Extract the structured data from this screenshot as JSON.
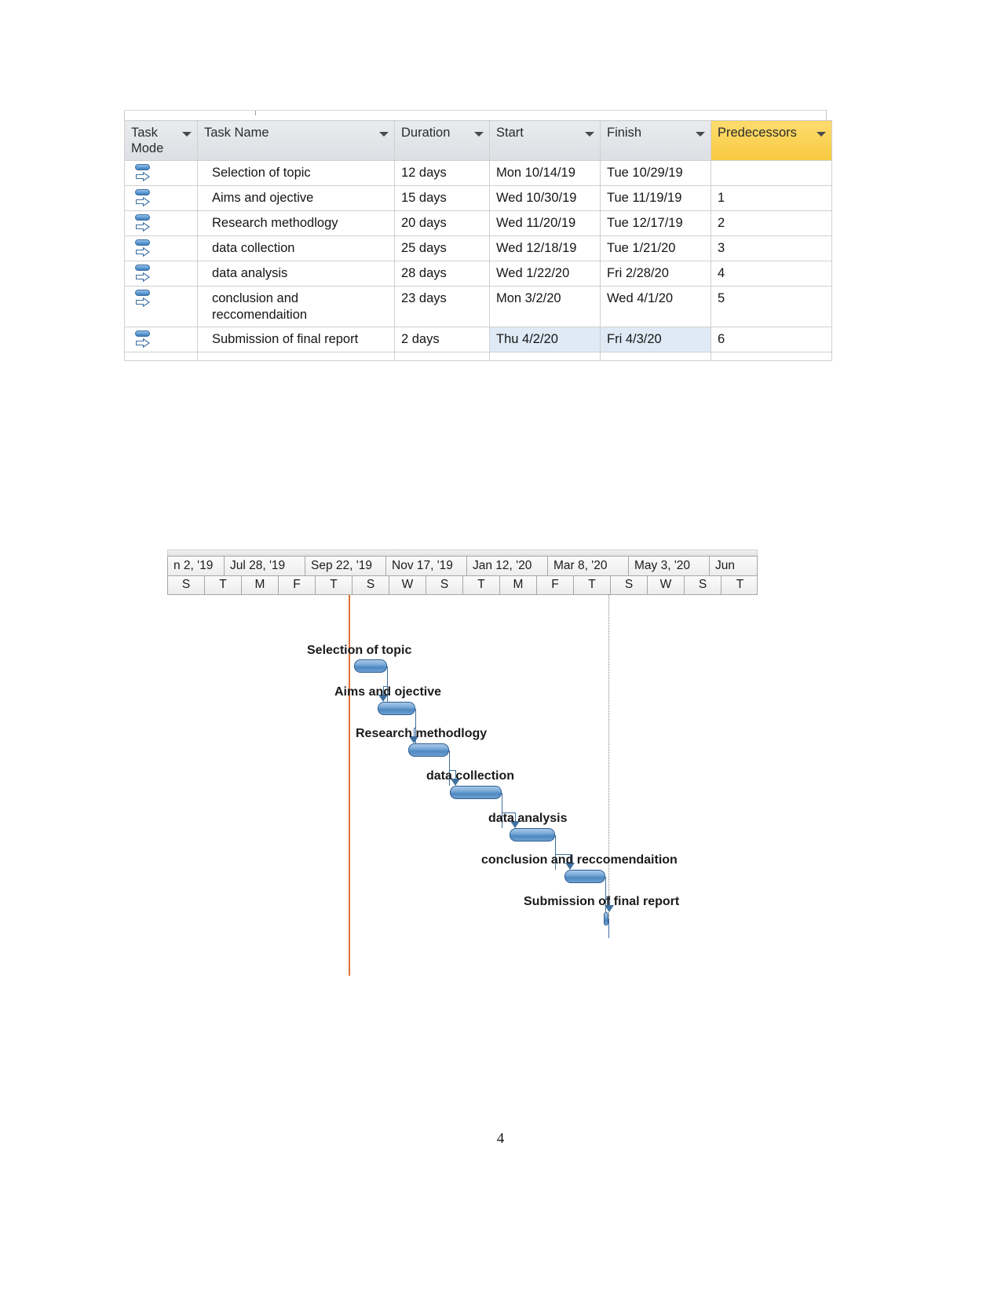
{
  "task_table": {
    "columns": [
      {
        "key": "mode",
        "label": "Task\nMode",
        "highlight": false
      },
      {
        "key": "name",
        "label": "Task Name",
        "highlight": false
      },
      {
        "key": "duration",
        "label": "Duration",
        "highlight": false
      },
      {
        "key": "start",
        "label": "Start",
        "highlight": false
      },
      {
        "key": "finish",
        "label": "Finish",
        "highlight": false
      },
      {
        "key": "pred",
        "label": "Predecessors",
        "highlight": true
      }
    ],
    "header_highlight_color": "#fccf4d",
    "header_bg_color": "#dfe2e5",
    "selected_row_color": "#dfeaf6",
    "mode_icon": "auto-schedule-icon",
    "rows": [
      {
        "mode_icon": "auto-schedule-icon",
        "name": "Selection of topic",
        "duration": "12 days",
        "start": "Mon 10/14/19",
        "finish": "Tue 10/29/19",
        "pred": "",
        "selected": false
      },
      {
        "mode_icon": "auto-schedule-icon",
        "name": "Aims and ojective",
        "duration": "15 days",
        "start": "Wed 10/30/19",
        "finish": "Tue 11/19/19",
        "pred": "1",
        "selected": false
      },
      {
        "mode_icon": "auto-schedule-icon",
        "name": "Research methodlogy",
        "duration": "20 days",
        "start": "Wed 11/20/19",
        "finish": "Tue 12/17/19",
        "pred": "2",
        "selected": false
      },
      {
        "mode_icon": "auto-schedule-icon",
        "name": "data collection",
        "duration": "25 days",
        "start": "Wed 12/18/19",
        "finish": "Tue 1/21/20",
        "pred": "3",
        "selected": false
      },
      {
        "mode_icon": "auto-schedule-icon",
        "name": "data analysis",
        "duration": "28 days",
        "start": "Wed 1/22/20",
        "finish": "Fri 2/28/20",
        "pred": "4",
        "selected": false
      },
      {
        "mode_icon": "auto-schedule-icon",
        "name": "conclusion and reccomendaition",
        "duration": "23 days",
        "start": "Mon 3/2/20",
        "finish": "Wed 4/1/20",
        "pred": "5",
        "selected": false
      },
      {
        "mode_icon": "auto-schedule-icon",
        "name": "Submission of final report",
        "duration": "2 days",
        "start": "Thu 4/2/20",
        "finish": "Fri 4/3/20",
        "pred": "6",
        "selected": true
      }
    ]
  },
  "chart_data": {
    "type": "bar",
    "chart_kind": "gantt",
    "title": "",
    "timeline_months": [
      {
        "label": "n 2, '19",
        "truncated": true
      },
      {
        "label": "Jul 28, '19",
        "truncated": false
      },
      {
        "label": "Sep 22, '19",
        "truncated": false
      },
      {
        "label": "Nov 17, '19",
        "truncated": false
      },
      {
        "label": "Jan 12, '20",
        "truncated": false
      },
      {
        "label": "Mar 8, '20",
        "truncated": false
      },
      {
        "label": "May 3, '20",
        "truncated": false
      },
      {
        "label": "Jun",
        "truncated": true
      }
    ],
    "timeline_days": [
      "S",
      "T",
      "M",
      "F",
      "T",
      "S",
      "W",
      "S",
      "T",
      "M",
      "F",
      "T",
      "S",
      "W",
      "S",
      "T"
    ],
    "today_line_color": "#e2703a",
    "finish_line_color": "#808080",
    "bar_color": "#4e87c0",
    "bar_border_color": "#2f5f91",
    "link_color": "#3f6f9f",
    "tasks": [
      {
        "name": "Selection of topic",
        "duration_days": 12,
        "start": "Mon 10/14/19",
        "finish": "Tue 10/29/19"
      },
      {
        "name": "Aims and ojective",
        "duration_days": 15,
        "start": "Wed 10/30/19",
        "finish": "Tue 11/19/19"
      },
      {
        "name": "Research methodlogy",
        "duration_days": 20,
        "start": "Wed 11/20/19",
        "finish": "Tue 12/17/19"
      },
      {
        "name": "data collection",
        "duration_days": 25,
        "start": "Wed 12/18/19",
        "finish": "Tue 1/21/20"
      },
      {
        "name": "data analysis",
        "duration_days": 28,
        "start": "Wed 1/22/20",
        "finish": "Fri 2/28/20"
      },
      {
        "name": "conclusion and reccomendaition",
        "duration_days": 23,
        "start": "Mon 3/2/20",
        "finish": "Wed 4/1/20"
      },
      {
        "name": "Submission of final report",
        "duration_days": 2,
        "start": "Thu 4/2/20",
        "finish": "Fri 4/3/20"
      }
    ]
  },
  "footer": {
    "page_number": "4"
  }
}
